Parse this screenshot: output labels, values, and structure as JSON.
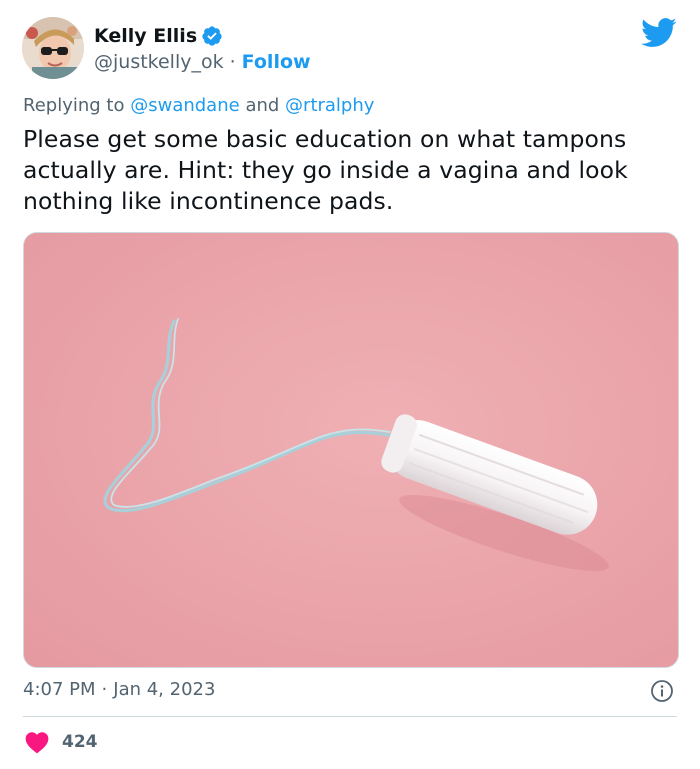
{
  "author": {
    "display_name": "Kelly Ellis",
    "handle": "@justkelly_ok",
    "separator": "·",
    "follow_label": "Follow"
  },
  "reply": {
    "prefix": "Replying to",
    "mention_1": "@swandane",
    "conjunction": "and",
    "mention_2": "@rtralphy"
  },
  "tweet": {
    "text": "Please get some basic education on what tampons actually are. Hint: they go inside a vagina and look nothing like incontinence pads."
  },
  "meta": {
    "time": "4:07 PM",
    "separator": "·",
    "date": "Jan 4, 2023"
  },
  "engagement": {
    "likes": "424"
  },
  "icons": {
    "verified": "verified-badge-icon",
    "brand": "twitter-bird-icon",
    "info": "info-icon",
    "like": "heart-icon"
  },
  "colors": {
    "brand_blue": "#1d9bf0",
    "like_red": "#f91880",
    "secondary_text": "#536471",
    "media_background": "#eba5aa"
  }
}
